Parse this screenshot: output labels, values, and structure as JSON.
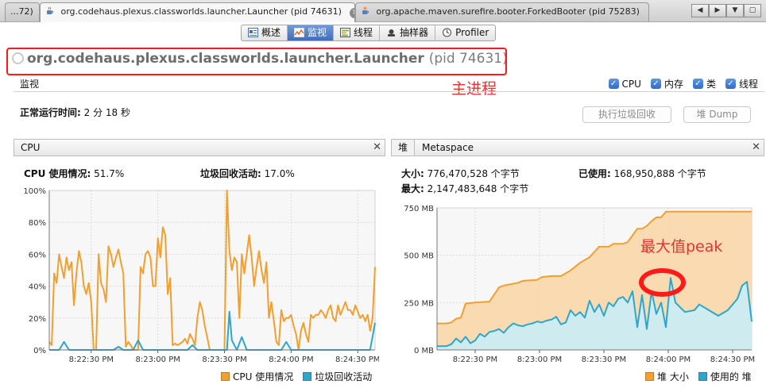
{
  "tabs": {
    "tab1_label": "...72)",
    "tab2_label": "org.codehaus.plexus.classworlds.launcher.Launcher (pid 74631)",
    "tab3_label": "org.apache.maven.surefire.booter.ForkedBooter (pid 75283)",
    "close_glyph": "✕"
  },
  "subtabs": [
    {
      "label": "概述"
    },
    {
      "label": "监视"
    },
    {
      "label": "线程"
    },
    {
      "label": "抽样器"
    },
    {
      "label": "Profiler"
    }
  ],
  "process": {
    "name": "org.codehaus.plexus.classworlds.launcher.Launcher",
    "pid": "(pid 74631)"
  },
  "annotations": {
    "main_process": "主进程",
    "peak": "最大值peak"
  },
  "monitor": {
    "title": "监视",
    "checks": [
      {
        "label": "CPU"
      },
      {
        "label": "内存"
      },
      {
        "label": "类"
      },
      {
        "label": "线程"
      }
    ],
    "uptime_label": "正常运行时间:",
    "uptime_value": "2 分 18 秒",
    "gc_button": "执行垃圾回收",
    "dump_button": "堆 Dump"
  },
  "cpu_panel": {
    "title": "CPU",
    "usage_label": "CPU 使用情况:",
    "usage_value": "51.7%",
    "gc_label": "垃圾回收活动:",
    "gc_value": "17.0%"
  },
  "heap_panel": {
    "tab_heap": "堆",
    "tab_meta": "Metaspace",
    "size_label": "大小:",
    "size_value": "776,470,528 个字节",
    "max_label": "最大:",
    "max_value": "2,147,483,648 个字节",
    "used_label": "已使用:",
    "used_value": "168,950,888 个字节"
  },
  "colors": {
    "cpu": "#f0a030",
    "gc": "#2ea6cc",
    "heap_size_line": "#f0a030",
    "heap_size_fill": "#f8d6a8",
    "heap_used_line": "#2ea6cc",
    "heap_used_fill": "#c9ecf7",
    "annotation": "#e8322e"
  },
  "chart_data": [
    {
      "type": "line",
      "y_tick_labels": [
        "0%",
        "20%",
        "40%",
        "60%",
        "80%",
        "100%"
      ],
      "ylim": [
        0,
        100
      ],
      "x_tick_labels": [
        "8:22:30 PM",
        "8:23:00 PM",
        "8:23:30 PM",
        "8:24:00 PM",
        "8:24:30 PM"
      ],
      "xlim": [
        0,
        132
      ],
      "grid": true,
      "legend_position": "bottom-right",
      "series": [
        {
          "name": "CPU 使用情况",
          "x": [
            0,
            1,
            2,
            3,
            4,
            5,
            6,
            7,
            8,
            9,
            10,
            11,
            12,
            13,
            14,
            15,
            16,
            17,
            18,
            19,
            20,
            21,
            22,
            23,
            24,
            25,
            26,
            27,
            28,
            29,
            30,
            31,
            32,
            33,
            34,
            35,
            36,
            37,
            38,
            39,
            40,
            41,
            42,
            43,
            44,
            45,
            46,
            47,
            48,
            49,
            50,
            51,
            52,
            53,
            54,
            55,
            56,
            57,
            58,
            59,
            60,
            61,
            62,
            63,
            64,
            65,
            66,
            67,
            68,
            69,
            70,
            71,
            72,
            73,
            74,
            75,
            76,
            77,
            78,
            79,
            80,
            81,
            82,
            83,
            84,
            85,
            86,
            87,
            88,
            89,
            90,
            91,
            92,
            93,
            94,
            95,
            96,
            97,
            98,
            99,
            100,
            101,
            102,
            103,
            104,
            105,
            106,
            107,
            108,
            109,
            110,
            111,
            112,
            113,
            114,
            115,
            116,
            117,
            118,
            119,
            120,
            121,
            122,
            123,
            124,
            125,
            126,
            127,
            128,
            129,
            130,
            131,
            132
          ],
          "values": [
            5,
            3,
            48,
            42,
            60,
            52,
            45,
            58,
            50,
            55,
            28,
            48,
            62,
            55,
            40,
            35,
            42,
            30,
            0,
            0,
            60,
            42,
            38,
            30,
            65,
            60,
            52,
            58,
            63,
            55,
            48,
            2,
            5,
            3,
            0,
            0,
            0,
            52,
            48,
            60,
            62,
            58,
            40,
            40,
            70,
            58,
            77,
            72,
            35,
            45,
            3,
            4,
            3,
            4,
            5,
            7,
            4,
            10,
            7,
            3,
            20,
            30,
            25,
            15,
            8,
            0,
            0,
            0,
            0,
            0,
            0,
            0,
            100,
            62,
            50,
            58,
            55,
            20,
            60,
            48,
            60,
            72,
            58,
            40,
            52,
            62,
            50,
            42,
            55,
            20,
            30,
            18,
            5,
            3,
            25,
            18,
            20,
            20,
            22,
            15,
            10,
            0,
            12,
            17,
            10,
            5,
            22,
            20,
            22,
            22,
            25,
            23,
            20,
            25,
            28,
            20,
            18,
            28,
            22,
            26,
            30,
            25,
            25,
            22,
            28,
            24,
            20,
            22,
            18,
            22,
            12,
            20,
            52
          ]
        },
        {
          "name": "垃圾回收活动",
          "x": [
            0,
            4,
            6,
            8,
            10,
            12,
            14,
            16,
            18,
            20,
            22,
            24,
            26,
            28,
            30,
            32,
            34,
            36,
            38,
            40,
            42,
            44,
            46,
            48,
            50,
            52,
            54,
            56,
            58,
            60,
            62,
            64,
            66,
            68,
            70,
            72,
            73,
            74,
            76,
            78,
            80,
            82,
            84,
            86,
            88,
            90,
            92,
            94,
            96,
            98,
            100,
            102,
            104,
            106,
            108,
            110,
            112,
            114,
            116,
            118,
            120,
            122,
            124,
            126,
            128,
            130,
            132
          ],
          "values": [
            0,
            0,
            5,
            0,
            0,
            0,
            0,
            0,
            0,
            0,
            0,
            0,
            0,
            2,
            0,
            0,
            0,
            6,
            0,
            0,
            0,
            0,
            0,
            0,
            0,
            0,
            0,
            0,
            3,
            0,
            0,
            0,
            0,
            0,
            0,
            0,
            24,
            6,
            0,
            8,
            0,
            0,
            0,
            0,
            0,
            0,
            0,
            0,
            5,
            0,
            0,
            0,
            0,
            0,
            0,
            0,
            0,
            0,
            0,
            0,
            0,
            0,
            0,
            0,
            0,
            0,
            17
          ]
        }
      ]
    },
    {
      "type": "area",
      "y_tick_labels": [
        "0 MB",
        "250 MB",
        "500 MB",
        "750 MB"
      ],
      "ylim": [
        0,
        750
      ],
      "x_tick_labels": [
        "8:22:30 PM",
        "8:23:00 PM",
        "8:23:30 PM",
        "8:24:00 PM",
        "8:24:30 PM"
      ],
      "xlim": [
        0,
        132
      ],
      "grid": true,
      "legend_position": "bottom-right",
      "series": [
        {
          "name": "堆 大小",
          "x": [
            0,
            4,
            6,
            8,
            10,
            12,
            16,
            22,
            26,
            28,
            34,
            36,
            42,
            44,
            48,
            52,
            56,
            60,
            64,
            68,
            72,
            74,
            78,
            80,
            84,
            86,
            88,
            90,
            92,
            94,
            96,
            132
          ],
          "values": [
            140,
            140,
            145,
            165,
            170,
            245,
            250,
            255,
            330,
            340,
            355,
            365,
            370,
            385,
            390,
            390,
            420,
            460,
            490,
            545,
            545,
            560,
            560,
            570,
            640,
            640,
            655,
            680,
            700,
            700,
            730,
            730
          ]
        },
        {
          "name": "使用的 堆",
          "x": [
            0,
            4,
            6,
            8,
            10,
            12,
            14,
            16,
            18,
            20,
            22,
            24,
            26,
            28,
            30,
            32,
            34,
            36,
            38,
            40,
            42,
            44,
            46,
            48,
            50,
            52,
            54,
            56,
            58,
            60,
            62,
            64,
            66,
            68,
            70,
            72,
            74,
            76,
            78,
            80,
            82,
            84,
            86,
            88,
            90,
            92,
            94,
            96,
            98,
            100,
            104,
            108,
            110,
            114,
            118,
            122,
            126,
            128,
            130,
            132
          ],
          "values": [
            20,
            20,
            30,
            60,
            40,
            70,
            35,
            50,
            85,
            70,
            95,
            100,
            110,
            90,
            120,
            140,
            130,
            125,
            135,
            140,
            150,
            145,
            155,
            160,
            175,
            135,
            145,
            210,
            180,
            200,
            170,
            260,
            200,
            240,
            180,
            250,
            230,
            270,
            280,
            250,
            310,
            120,
            290,
            110,
            310,
            190,
            250,
            120,
            380,
            250,
            200,
            210,
            240,
            210,
            180,
            210,
            270,
            340,
            360,
            150
          ]
        }
      ]
    }
  ]
}
